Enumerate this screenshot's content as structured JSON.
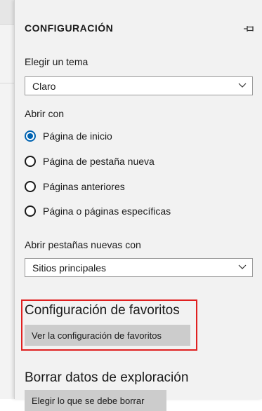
{
  "pane": {
    "title": "CONFIGURACIÓN",
    "pin_icon": "pin-icon"
  },
  "theme": {
    "label": "Elegir un tema",
    "selected": "Claro"
  },
  "open_with": {
    "label": "Abrir con",
    "options": [
      {
        "label": "Página de inicio",
        "checked": true
      },
      {
        "label": "Página de pestaña nueva",
        "checked": false
      },
      {
        "label": "Páginas anteriores",
        "checked": false
      },
      {
        "label": "Página o páginas específicas",
        "checked": false
      }
    ]
  },
  "new_tabs": {
    "label": "Abrir pestañas nuevas con",
    "selected": "Sitios principales"
  },
  "favorites": {
    "heading": "Configuración de favoritos",
    "button_label": "Ver la configuración de favoritos"
  },
  "clear_data": {
    "heading": "Borrar datos de exploración",
    "button_label": "Elegir lo que se debe borrar"
  },
  "colors": {
    "accent": "#0063b1",
    "highlight": "#e02020",
    "pane_background": "#f2f2f2",
    "button_background": "#cccccc"
  }
}
